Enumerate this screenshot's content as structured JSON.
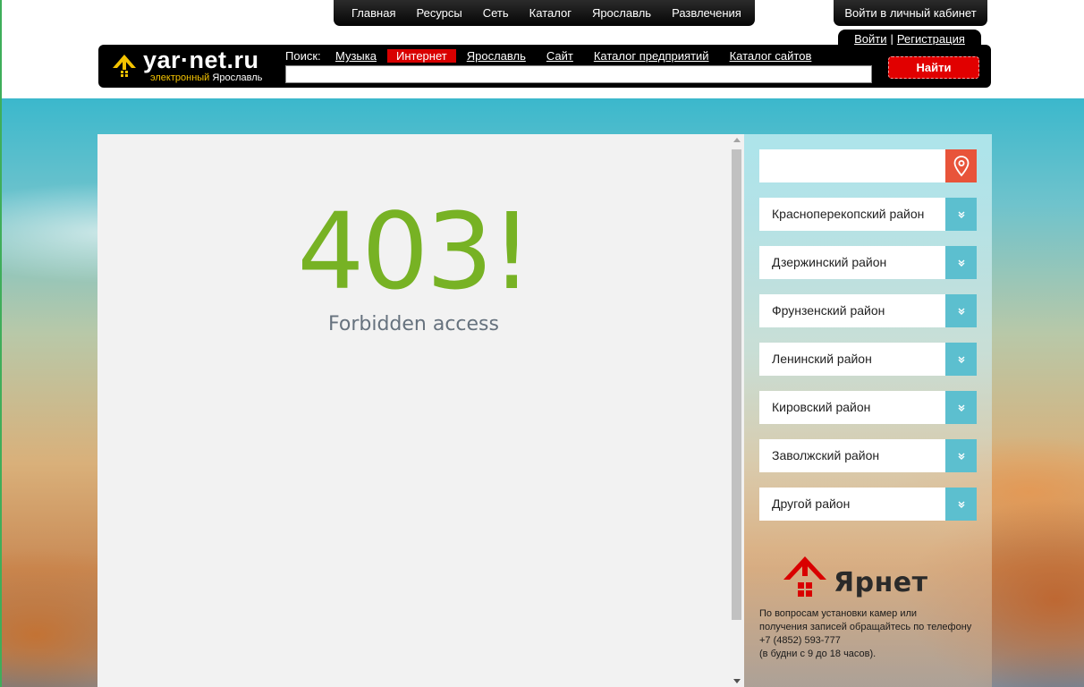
{
  "top_nav": {
    "items": [
      "Главная",
      "Ресурсы",
      "Сеть",
      "Каталог",
      "Ярославль",
      "Развлечения"
    ],
    "cabinet_label": "Войти в личный кабинет"
  },
  "auth": {
    "login": "Войти",
    "separator": "|",
    "register": "Регистрация"
  },
  "logo": {
    "name": "yar·net.ru",
    "tagline_accent": "электронный",
    "tagline_rest": "Ярославль"
  },
  "search": {
    "label": "Поиск:",
    "categories": [
      "Музыка",
      "Интернет",
      "Ярославль",
      "Сайт",
      "Каталог предприятий",
      "Каталог сайтов"
    ],
    "active_category": "Интернет",
    "query": "",
    "button_label": "Найти"
  },
  "error": {
    "code": "403!",
    "message": "Forbidden access"
  },
  "sidebar": {
    "address_value": "",
    "districts": [
      "Красноперекопский район",
      "Дзержинский район",
      "Фрунзенский район",
      "Ленинский район",
      "Кировский район",
      "Заволжский район",
      "Другой район"
    ],
    "brand": "Ярнет",
    "contact_lines": [
      "По вопросам установки камер или",
      "получения записей обращайтесь по телефону",
      "+7 (4852) 593-777",
      "(в будни с 9 до 18 часов)."
    ]
  },
  "colors": {
    "accent_green": "#77b224",
    "brand_red": "#e10000",
    "district_toggle": "#5cbfcf",
    "location_button": "#e8543a"
  },
  "icons": {
    "logo_mark": "yar-net-logo-icon",
    "location": "map-pin-icon",
    "toggle": "double-chevron-down-icon",
    "brand": "yarnet-house-icon"
  }
}
